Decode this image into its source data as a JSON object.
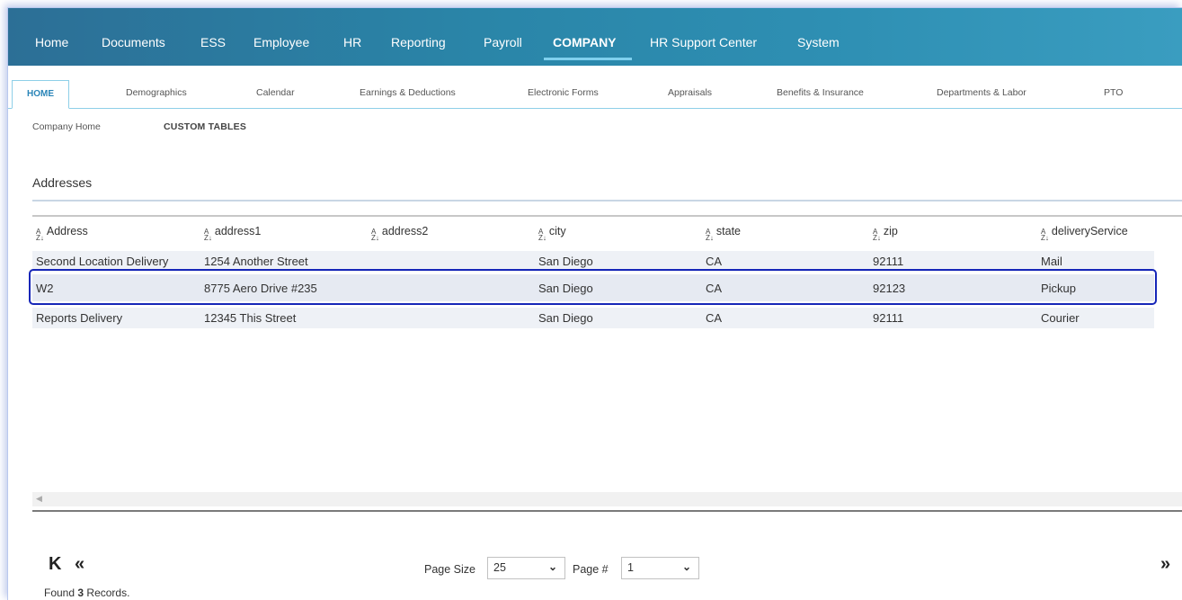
{
  "top_nav": {
    "items": [
      "Home",
      "Documents",
      "ESS",
      "Employee",
      "HR",
      "Reporting",
      "Payroll",
      "COMPANY",
      "HR Support Center",
      "System"
    ],
    "active": "COMPANY"
  },
  "sub_tabs": {
    "items": [
      "HOME",
      "Demographics",
      "Calendar",
      "Earnings & Deductions",
      "Electronic Forms",
      "Appraisals",
      "Benefits & Insurance",
      "Departments & Labor",
      "PTO"
    ],
    "active": "HOME"
  },
  "breadcrumbs": {
    "items": [
      "Company Home",
      "CUSTOM TABLES"
    ]
  },
  "section": {
    "title": "Addresses"
  },
  "table": {
    "columns": [
      "Address",
      "address1",
      "address2",
      "city",
      "state",
      "zip",
      "deliveryService"
    ],
    "rows": [
      [
        "Second Location Delivery",
        "1254 Another Street",
        "",
        "San Diego",
        "CA",
        "92111",
        "Mail"
      ],
      [
        "W2",
        "8775 Aero Drive #235",
        "",
        "San Diego",
        "CA",
        "92123",
        "Pickup"
      ],
      [
        "Reports Delivery",
        "12345 This Street",
        "",
        "San Diego",
        "CA",
        "92111",
        "Courier"
      ]
    ],
    "selected_row": 1
  },
  "icons": {
    "sort": "sort-az-icon",
    "first": "first-page-icon",
    "prev": "previous-page-icon",
    "next": "next-page-icon",
    "dropdown": "chevron-down-icon",
    "scroll_left": "scroll-left-arrow-icon"
  },
  "glyphs": {
    "first": "K",
    "prev": "«",
    "next": "»",
    "chevron": "⌄",
    "scroll_left": "◀",
    "sort_top": "A",
    "sort_bottom": "Z↓"
  },
  "pager": {
    "page_size_label": "Page Size",
    "page_size_value": "25",
    "page_num_label": "Page #",
    "page_num_value": "1",
    "found_prefix": "Found",
    "found_count": "3",
    "found_suffix": "Records."
  },
  "colors": {
    "nav_bg_start": "#2c6f96",
    "nav_bg_end": "#3a9dc0",
    "accent": "#2a85b8",
    "selection_border": "#1626b8"
  }
}
